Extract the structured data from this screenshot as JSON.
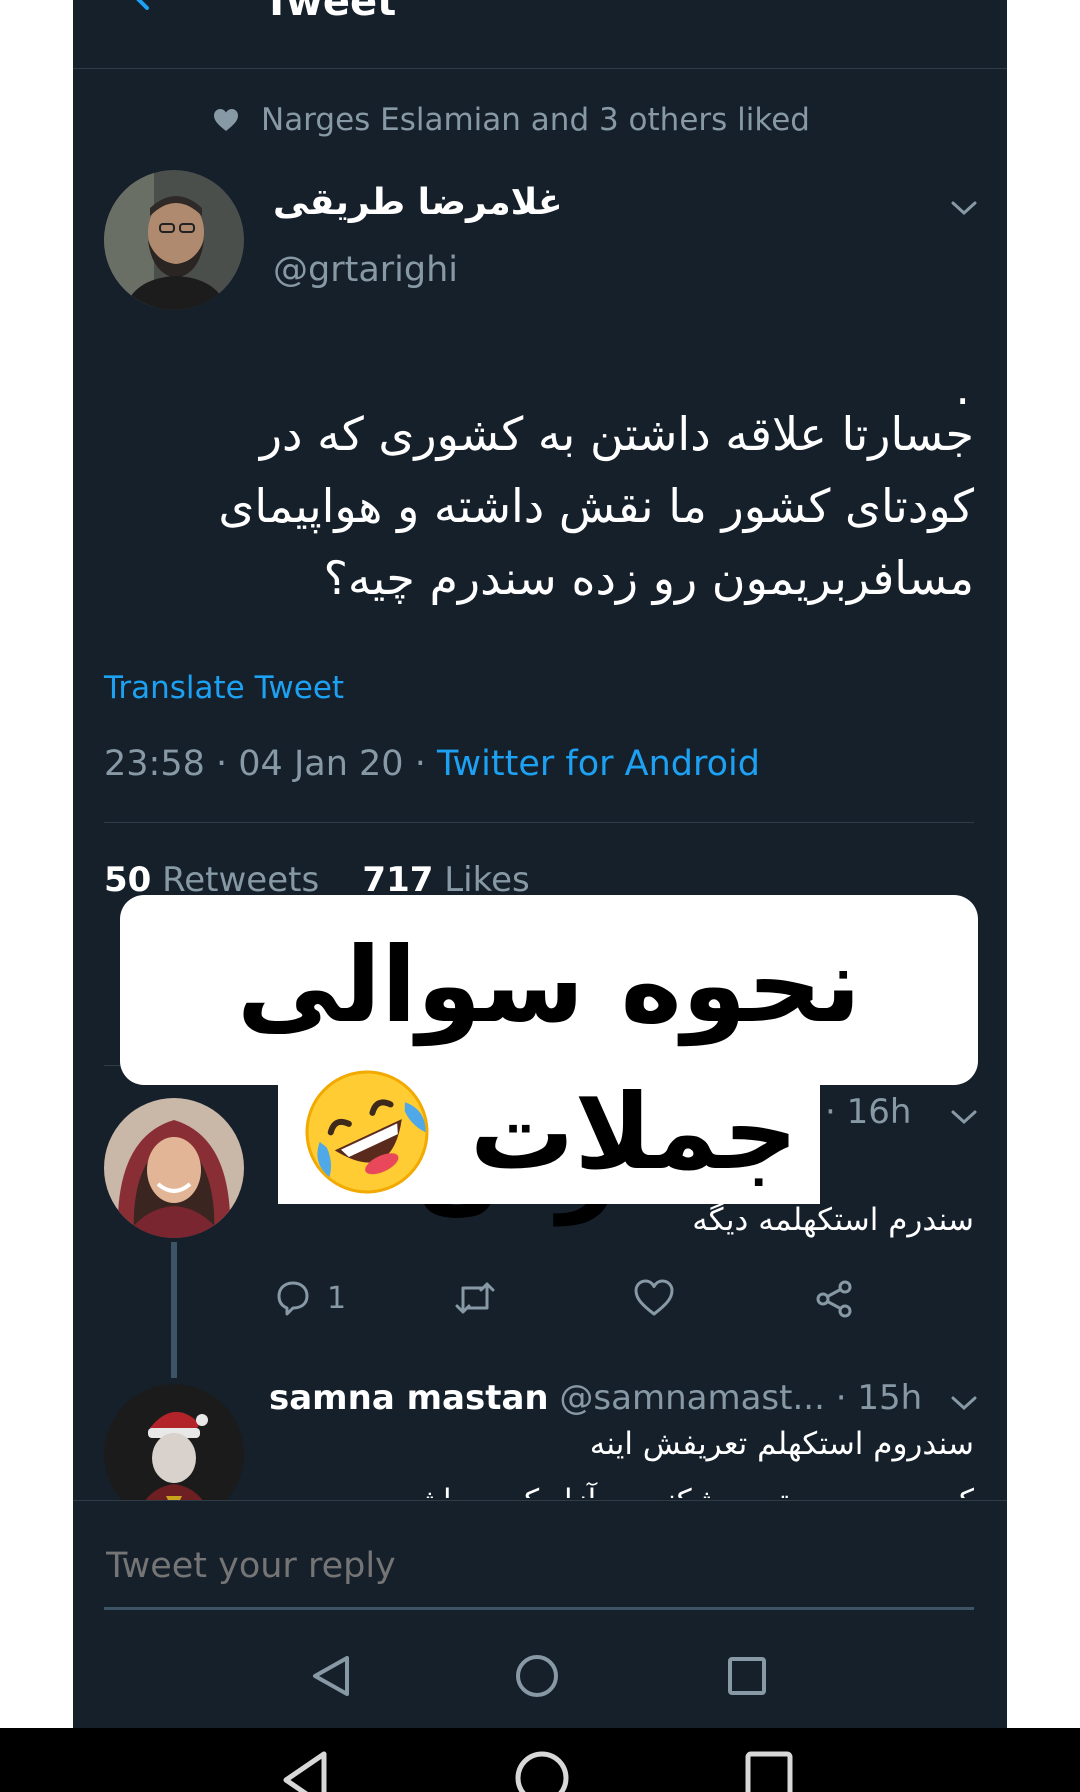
{
  "header": {
    "title": "Tweet"
  },
  "social_context": {
    "text": "Narges Eslamian and 3 others liked"
  },
  "tweet": {
    "author_name": "غلامرضا طریقی",
    "author_handle": "@grtarighi",
    "body_dot": ".",
    "body_lines": [
      "جسارتا علاقه داشتن به کشوری که در",
      "کودتای کشور ما نقش داشته و هواپیمای",
      "مسافربریمون رو زده سندرم چیه؟"
    ],
    "translate_label": "Translate Tweet",
    "time": "23:58",
    "date": "04 Jan 20",
    "source": "Twitter for Android",
    "retweets_count": "50",
    "retweets_label": "Retweets",
    "likes_count": "717",
    "likes_label": "Likes"
  },
  "overlay": {
    "line1": "نحوه سوالی کردن",
    "line2": "جملات",
    "emoji": "rolling-on-the-floor-laughing"
  },
  "replies": [
    {
      "time": "· 16h",
      "text": "سندرم استکهلمه دیگه",
      "reply_count": "1"
    },
    {
      "name": "samna mastan",
      "handle": "@samnamast...",
      "time": "· 15h",
      "text": "سندروم استکهلم تعریفش اینه",
      "text_cut": "کسی به مدت تحت شکنجه و آزار کسی باشه و بعد"
    }
  ],
  "composer": {
    "placeholder": "Tweet your reply"
  }
}
